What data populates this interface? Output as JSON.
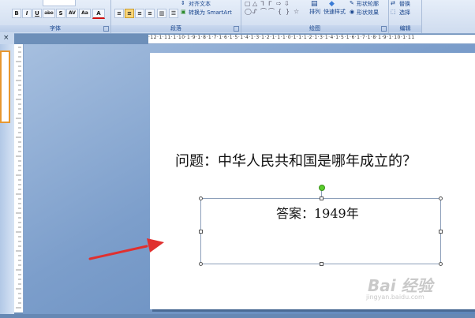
{
  "ribbon": {
    "font_group": {
      "label": "字体",
      "buttons": [
        {
          "name": "bold-button",
          "text": "B"
        },
        {
          "name": "italic-button",
          "text": "I"
        },
        {
          "name": "underline-button",
          "text": "U"
        },
        {
          "name": "strikethrough-button",
          "text": "abe"
        },
        {
          "name": "shadow-button",
          "text": "S"
        },
        {
          "name": "char-spacing-button",
          "text": "AV"
        },
        {
          "name": "change-case-button",
          "text": "Aa"
        },
        {
          "name": "font-color-button",
          "text": "A"
        }
      ]
    },
    "paragraph_group": {
      "label": "段落",
      "align_text_label": "对齐文本",
      "smartart_label": "转换为 SmartArt"
    },
    "drawing_group": {
      "label": "绘图",
      "arrange_label": "排列",
      "quick_styles_label": "快速样式",
      "shape_outline_label": "形状轮廓",
      "shape_effects_label": "形状效果"
    },
    "editing_group": {
      "label": "编辑",
      "replace_label": "替换",
      "select_label": "选择"
    }
  },
  "left_pane": {
    "close_glyph": "×"
  },
  "ruler": {
    "horizontal_text": "·12·1·11·1·10·1·9·1·8·1·7·1·6·1·5·1·4·1·3·1·2·1·1·1·0·1·1·1·2·1·3·1·4·1·5·1·6·1·7·1·8·1·9·1·10·1·11"
  },
  "slide": {
    "question": "问题：中华人民共和国是哪年成立的？",
    "answer": "答案：1949年"
  },
  "watermark": {
    "main": "Bai 经验",
    "sub": "jingyan.baidu.com"
  },
  "colors": {
    "arrow": "#e0302f",
    "selection_border": "#8c9fb9",
    "rotation_handle": "#5acd2c",
    "thumbnail_border": "#e79831"
  }
}
